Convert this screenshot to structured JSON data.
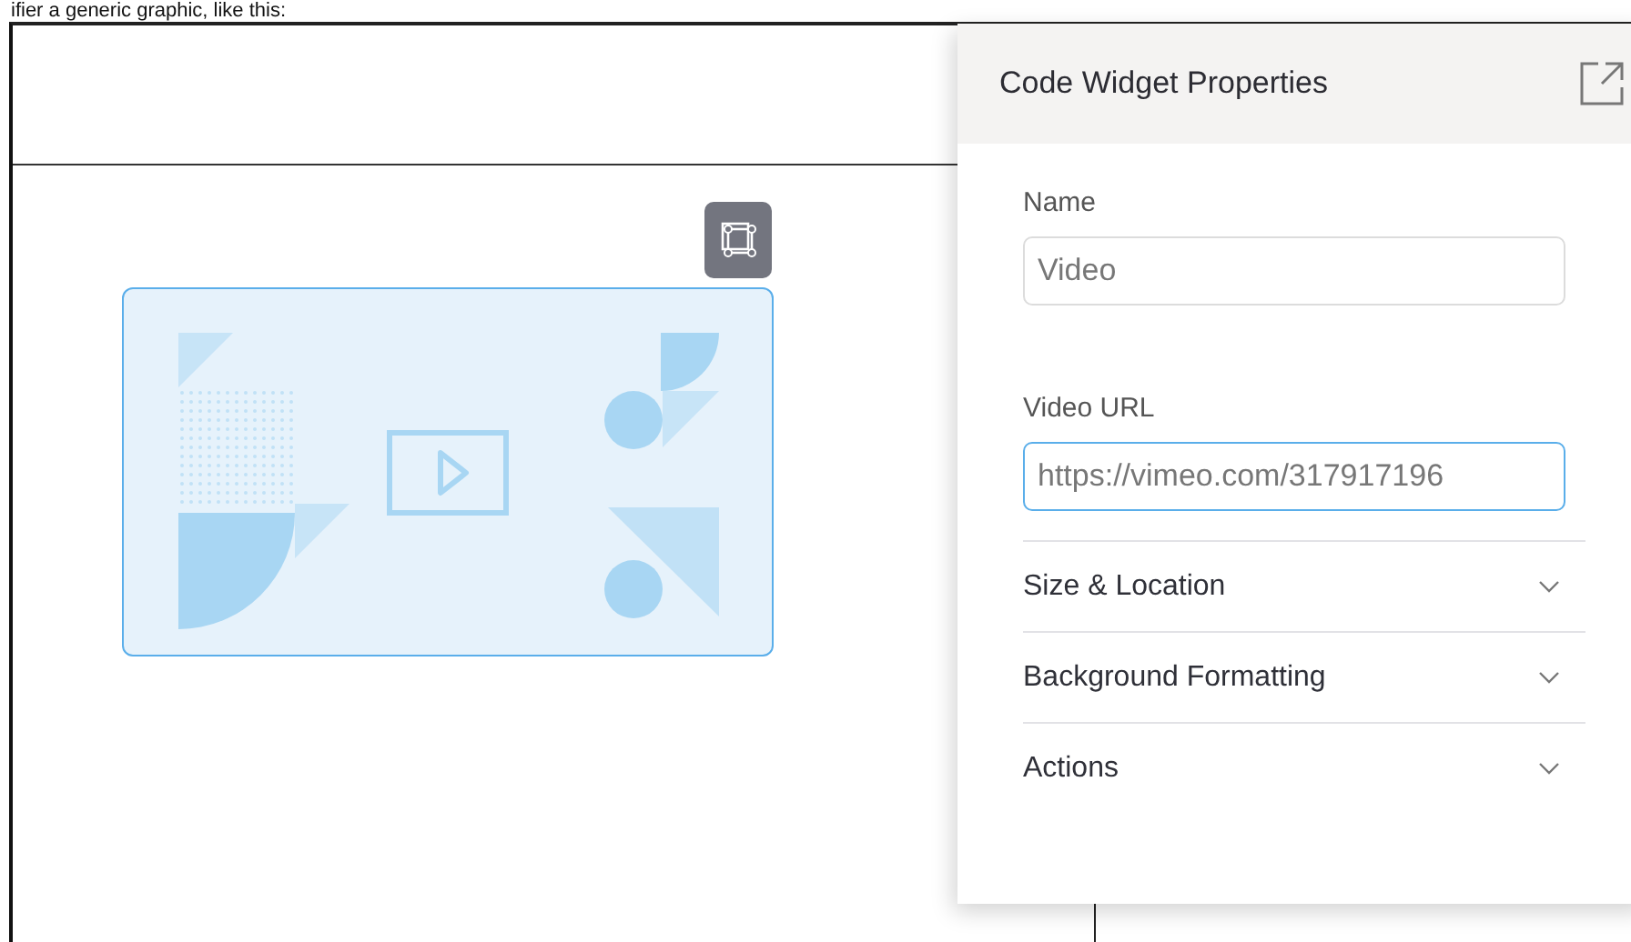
{
  "caption": "ifier a generic graphic, like this:",
  "panel": {
    "title": "Code Widget Properties",
    "fields": [
      {
        "label": "Name",
        "value": "Video",
        "focused": false
      },
      {
        "label": "Video URL",
        "value": "https://vimeo.com/317917196",
        "focused": true
      }
    ],
    "sections": [
      {
        "label": "Size & Location",
        "expanded": false
      },
      {
        "label": "Background Formatting",
        "expanded": false
      },
      {
        "label": "Actions",
        "expanded": false
      }
    ]
  }
}
